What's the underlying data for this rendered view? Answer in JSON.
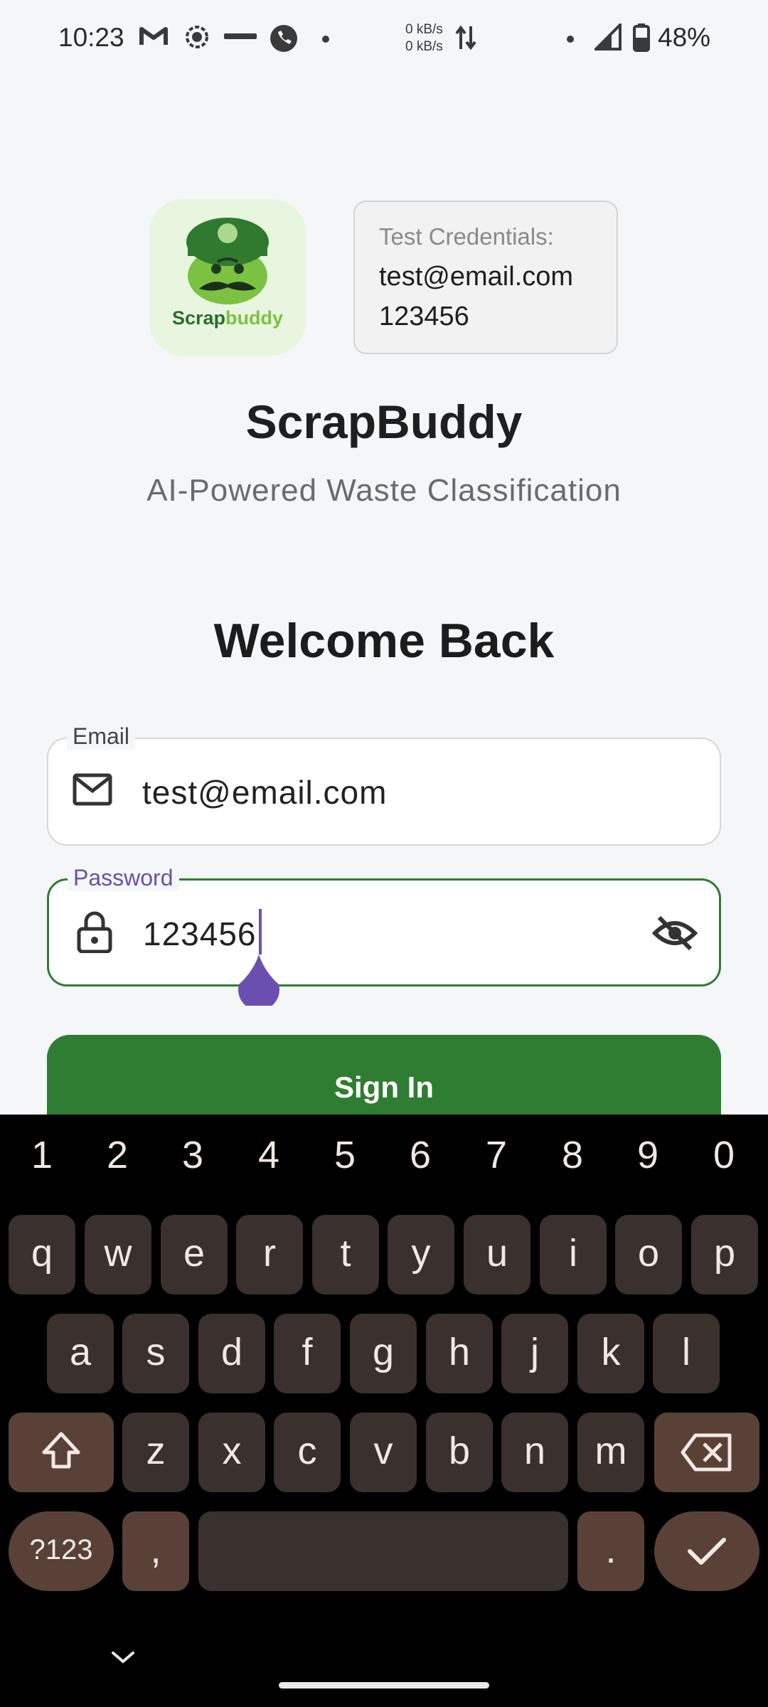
{
  "status_bar": {
    "time": "10:23",
    "net_up": "0 kB/s",
    "net_down": "0 kB/s",
    "battery": "48%"
  },
  "header": {
    "logo_text_part1": "Scrap",
    "logo_text_part2": "buddy",
    "credentials_title": "Test Credentials:",
    "credentials_email": "test@email.com",
    "credentials_password": "123456",
    "app_title": "ScrapBuddy",
    "app_subtitle": "AI-Powered Waste Classification"
  },
  "form": {
    "welcome": "Welcome Back",
    "email_label": "Email",
    "email_value": "test@email.com",
    "password_label": "Password",
    "password_value": "123456",
    "signin_label": "Sign In"
  },
  "keyboard": {
    "numbers": [
      "1",
      "2",
      "3",
      "4",
      "5",
      "6",
      "7",
      "8",
      "9",
      "0"
    ],
    "row1": [
      "q",
      "w",
      "e",
      "r",
      "t",
      "y",
      "u",
      "i",
      "o",
      "p"
    ],
    "row2": [
      "a",
      "s",
      "d",
      "f",
      "g",
      "h",
      "j",
      "k",
      "l"
    ],
    "row3": [
      "z",
      "x",
      "c",
      "v",
      "b",
      "n",
      "m"
    ],
    "symbols_label": "?123",
    "comma": ",",
    "period": "."
  },
  "colors": {
    "primary_green": "#2e7d32",
    "accent_purple": "#6a4fb0",
    "logo_green": "#7cc242"
  }
}
